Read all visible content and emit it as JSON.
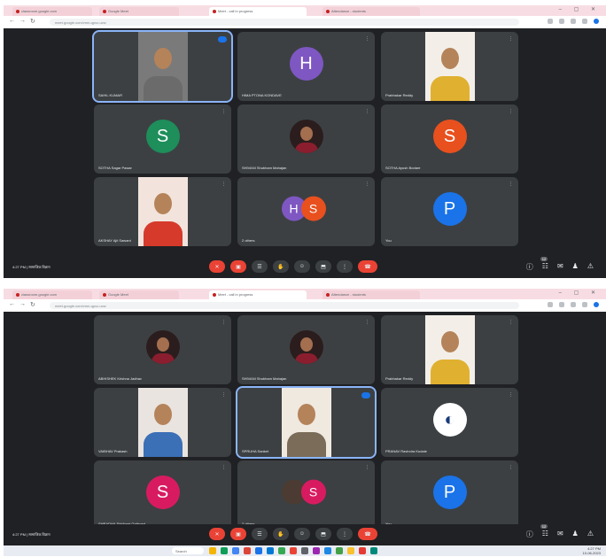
{
  "shot1": {
    "browser": {
      "tabs": [
        {
          "label": "classroom.google.com",
          "active": false
        },
        {
          "label": "Google Meet",
          "active": false
        },
        {
          "label": "Meet - call in progress",
          "active": true
        },
        {
          "label": "Attendance - students",
          "active": false
        }
      ],
      "window_controls": "– ▢ ✕",
      "address": "meet.google.com/vmn-qpxz-uvw"
    },
    "tiles": [
      {
        "name": "SAHIL KUMAR",
        "kind": "photo",
        "speaking": true,
        "shirt": "#6b6b6b",
        "bg": "#7a7a7a"
      },
      {
        "name": "HIMA PTONA KONDAVE",
        "kind": "avatar",
        "letter": "H",
        "color": "#7e57c2"
      },
      {
        "name": "Prabhakar Reddy",
        "kind": "photo",
        "shirt": "#e0b030",
        "bg": "#f3efe8"
      },
      {
        "name": "SOTHA Sagar Pawar",
        "kind": "avatar",
        "letter": "S",
        "color": "#1e8e5a"
      },
      {
        "name": "SHIVANI Shubham Mahajan",
        "kind": "round"
      },
      {
        "name": "SOTHA Ayush Bodare",
        "kind": "avatar",
        "letter": "S",
        "color": "#e8501e"
      },
      {
        "name": "AKSHAY Ajit Sawant",
        "kind": "photo",
        "shirt": "#d63a2b",
        "bg": "#f2e4dc"
      },
      {
        "name": "2 others",
        "kind": "pair",
        "letters": [
          "H",
          "S"
        ],
        "colors": [
          "#7e57c2",
          "#e8501e"
        ]
      },
      {
        "name": "You",
        "kind": "avatar",
        "letter": "P",
        "color": "#1a73e8"
      }
    ],
    "bottom": {
      "meeting_info": "4:27 PM | सामाजिक विज्ञान"
    }
  },
  "shot2": {
    "browser": {
      "tabs": [
        {
          "label": "classroom.google.com",
          "active": false
        },
        {
          "label": "Google Meet",
          "active": false
        },
        {
          "label": "Meet - call in progress",
          "active": true
        },
        {
          "label": "Attendance - students",
          "active": false
        }
      ],
      "window_controls": "– ▢ ✕",
      "address": "meet.google.com/vmn-qpxz-uvw"
    },
    "tiles": [
      {
        "name": "ABHISHEK Krishna Jadhav",
        "kind": "round"
      },
      {
        "name": "SHIVANI Shubham Mahajan",
        "kind": "round"
      },
      {
        "name": "Prabhakar Reddy",
        "kind": "photo",
        "shirt": "#e0b030",
        "bg": "#f3efe8"
      },
      {
        "name": "VAIBHAV Prakash",
        "kind": "photo",
        "shirt": "#3b6fb6",
        "bg": "#e9e4df"
      },
      {
        "name": "SPRUHA Sanket",
        "kind": "photo",
        "speaking": true,
        "shirt": "#7a6c58",
        "bg": "#efe9e0"
      },
      {
        "name": "PRANAV Ravindra Kudale",
        "kind": "avatar",
        "letter": "◐",
        "color": "#ffffff"
      },
      {
        "name": "SHRADHA Siddhant Gaikwad",
        "kind": "avatar",
        "letter": "S",
        "color": "#d81b60"
      },
      {
        "name": "2 others",
        "kind": "pair",
        "letters": [
          "",
          "S"
        ],
        "colors": [
          "#4b3b32",
          "#d81b60"
        ]
      },
      {
        "name": "You",
        "kind": "avatar",
        "letter": "P",
        "color": "#1a73e8"
      }
    ],
    "bottom": {
      "meeting_info": "4:27 PM | सामाजिक विज्ञान"
    },
    "taskbar": {
      "search": "Search",
      "time": "4:27 PM",
      "date": "10-06-2023"
    }
  },
  "controls": [
    {
      "name": "mic-button",
      "glyph": "✕",
      "red": true
    },
    {
      "name": "camera-button",
      "glyph": "▣",
      "red": true
    },
    {
      "name": "captions-button",
      "glyph": "☰",
      "red": false
    },
    {
      "name": "raise-hand-button",
      "glyph": "✋",
      "red": false
    },
    {
      "name": "reactions-button",
      "glyph": "☺",
      "red": false
    },
    {
      "name": "present-button",
      "glyph": "⬒",
      "red": false
    },
    {
      "name": "more-options-button",
      "glyph": "⋮",
      "red": false
    },
    {
      "name": "leave-call-button",
      "glyph": "☎",
      "red": true
    }
  ],
  "right_controls": [
    {
      "name": "info-icon",
      "glyph": "ⓘ"
    },
    {
      "name": "people-icon",
      "glyph": "☷",
      "badge": "12"
    },
    {
      "name": "chat-icon",
      "glyph": "✉"
    },
    {
      "name": "activities-icon",
      "glyph": "♟"
    },
    {
      "name": "host-controls-icon",
      "glyph": "⚠"
    }
  ],
  "taskbar_icon_colors": [
    "#f4b400",
    "#0f9d58",
    "#4285f4",
    "#db4437",
    "#1a73e8",
    "#0078d4",
    "#34a853",
    "#ea4335",
    "#5f6368",
    "#9c27b0",
    "#1e88e5",
    "#43a047",
    "#fbc02d",
    "#e53935",
    "#00897b"
  ]
}
